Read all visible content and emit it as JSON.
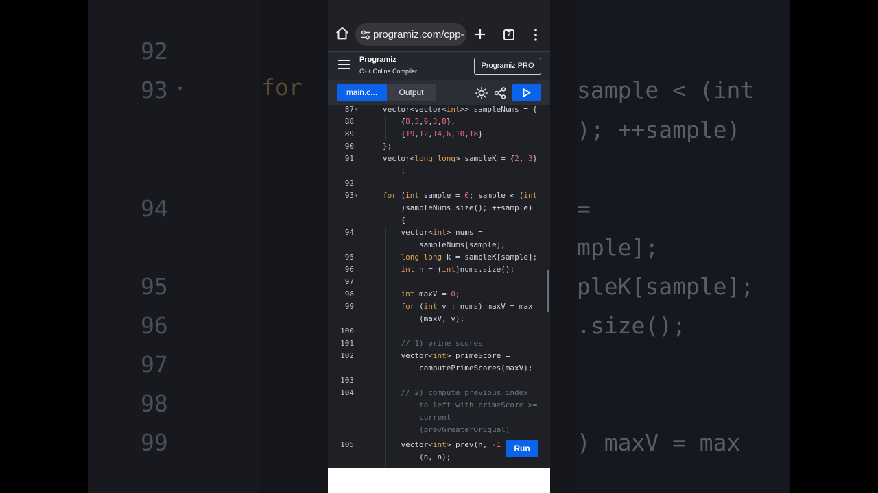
{
  "background": {
    "line_numbers": [
      "92",
      "93",
      "94",
      "95",
      "96",
      "97",
      "98",
      "99"
    ],
    "keyword": "for",
    "code_fragments": [
      "sample < (int",
      "); ++sample)",
      "=",
      "mple];",
      "pleK[sample];",
      ".size();",
      ") maxV = max"
    ]
  },
  "browser": {
    "url": "programiz.com/cpp-p",
    "tab_count": "7",
    "icons": [
      "home-icon",
      "site-settings-icon",
      "plus-icon",
      "tabs-icon",
      "more-vert-icon"
    ]
  },
  "app": {
    "logo": "Programiz",
    "subtitle": "C++ Online Compiler",
    "pro_button": "Programiz PRO",
    "tabs": {
      "main": "main.c...",
      "output": "Output"
    },
    "run_button": "Run",
    "accent_color": "#0b63ec"
  },
  "editor": {
    "line_numbers": [
      "87",
      "88",
      "89",
      "90",
      "91",
      "92",
      "93",
      "94",
      "95",
      "96",
      "97",
      "98",
      "99",
      "100",
      "101",
      "102",
      "103",
      "104",
      "105"
    ]
  }
}
